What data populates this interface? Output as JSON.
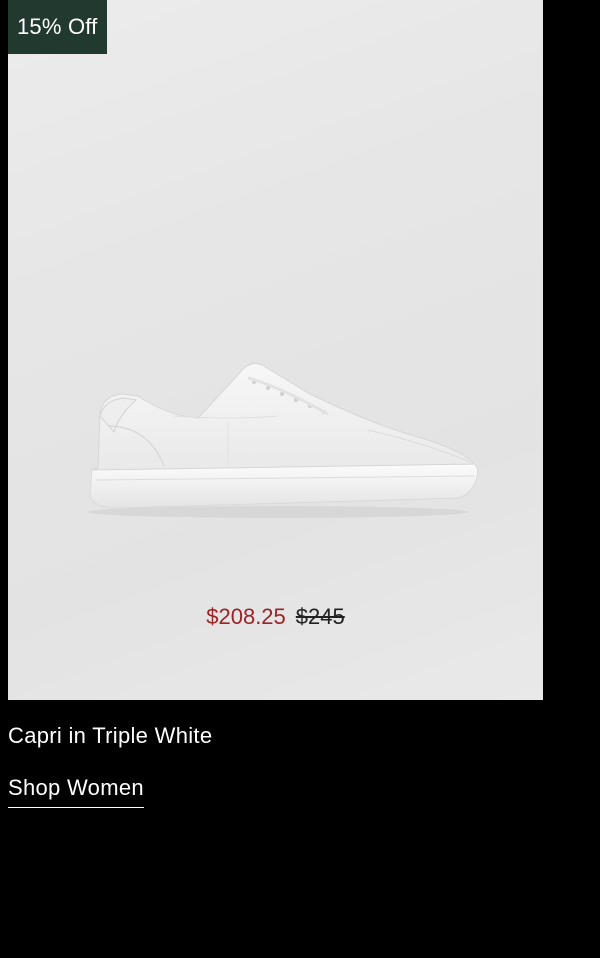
{
  "product": {
    "badge": "15% Off",
    "name": "Capri in Triple White",
    "sale_price": "$208.25",
    "original_price": "$245",
    "shop_link": "Shop Women",
    "image": "white-leather-sneaker",
    "colors": {
      "badge_bg": "#22392f",
      "sale_price": "#9b2226",
      "page_bg": "#000000",
      "image_bg": "#e6e6e6"
    }
  }
}
